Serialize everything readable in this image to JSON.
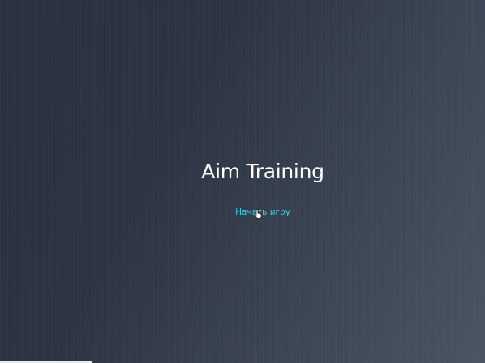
{
  "game": {
    "title": "Aim Training",
    "start_label": "Начать игру"
  },
  "colors": {
    "background_dark": "#29303f",
    "background_light": "#4a5463",
    "title": "#ffffff",
    "link": "#3ad2e0"
  },
  "icons": {
    "cursor": "hand-pointer-icon"
  }
}
